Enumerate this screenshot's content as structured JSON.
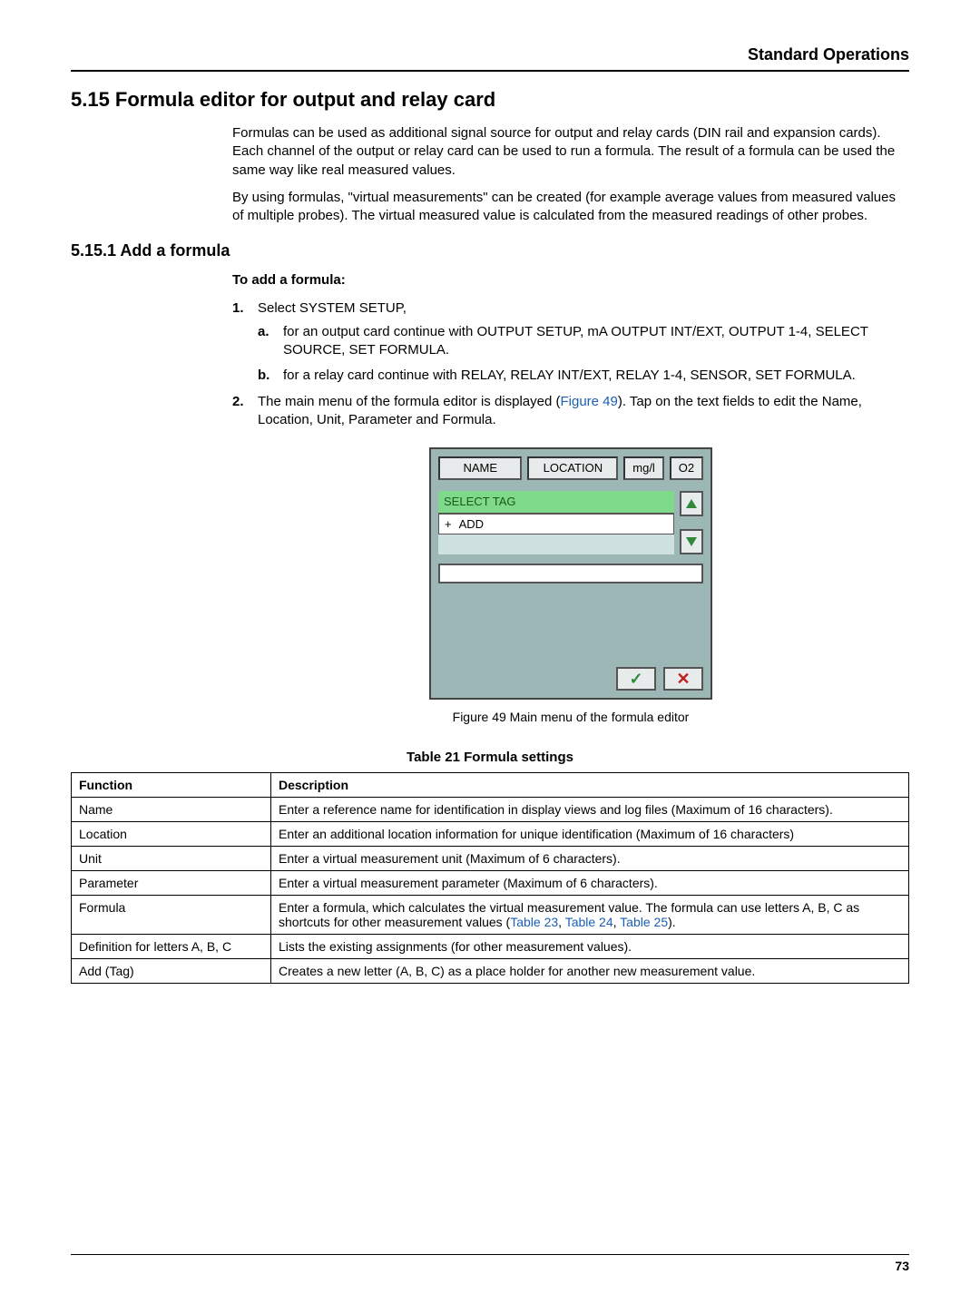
{
  "header": {
    "title": "Standard Operations"
  },
  "section": {
    "number_title": "5.15 Formula editor for output and relay card",
    "para1": "Formulas can be used as additional signal source for output and relay cards (DIN rail and expansion cards). Each channel of the output or relay card can be used to run a formula. The result of a formula can be used the same way like real measured values.",
    "para2": "By using formulas, \"virtual measurements\" can be created (for example average values from measured values of multiple probes). The virtual measured value is calculated from the measured readings of other probes."
  },
  "subsection": {
    "heading": "5.15.1 Add a formula",
    "lead": "To add a formula:",
    "steps": {
      "s1_marker": "1.",
      "s1_text": "Select SYSTEM SETUP,",
      "s1a_marker": "a.",
      "s1a_text": "for an output card continue with OUTPUT SETUP, mA OUTPUT INT/EXT, OUTPUT 1-4, SELECT SOURCE, SET FORMULA.",
      "s1b_marker": "b.",
      "s1b_text": "for a relay card continue with RELAY, RELAY INT/EXT, RELAY 1-4, SENSOR, SET FORMULA.",
      "s2_marker": "2.",
      "s2_text_before": "The main menu of the formula editor is displayed (",
      "s2_figref": "Figure 49",
      "s2_text_after": "). Tap on the text fields to edit the Name, Location, Unit, Parameter and Formula."
    }
  },
  "figure": {
    "fields": {
      "name": "NAME",
      "location": "LOCATION",
      "unit": "mg/l",
      "param": "O2"
    },
    "select_tag": "SELECT TAG",
    "add_plus": "+",
    "add_label": "ADD",
    "caption": "Figure 49  Main menu of the formula editor"
  },
  "table": {
    "caption": "Table 21   Formula settings",
    "head_func": "Function",
    "head_desc": "Description",
    "rows": [
      {
        "func": "Name",
        "desc": "Enter a reference name for identification in display views and log files (Maximum of 16 characters)."
      },
      {
        "func": "Location",
        "desc": "Enter an additional location information for unique identification (Maximum of 16 characters)"
      },
      {
        "func": "Unit",
        "desc": "Enter a virtual measurement unit (Maximum of 6 characters)."
      },
      {
        "func": "Parameter",
        "desc": "Enter a virtual measurement parameter (Maximum of 6 characters)."
      },
      {
        "func": "Formula",
        "desc_before": "Enter a formula, which calculates the virtual measurement value. The formula can use letters A, B, C as shortcuts for other measurement values (",
        "link1": "Table 23",
        "sep1": ", ",
        "link2": "Table 24",
        "sep2": ", ",
        "link3": "Table 25",
        "desc_after": ")."
      },
      {
        "func": "Definition for letters A, B, C",
        "desc": "Lists the existing assignments (for other measurement values)."
      },
      {
        "func": "Add (Tag)",
        "desc": "Creates a new letter (A, B, C) as a place holder for another new measurement value."
      }
    ]
  },
  "footer": {
    "page": "73"
  }
}
